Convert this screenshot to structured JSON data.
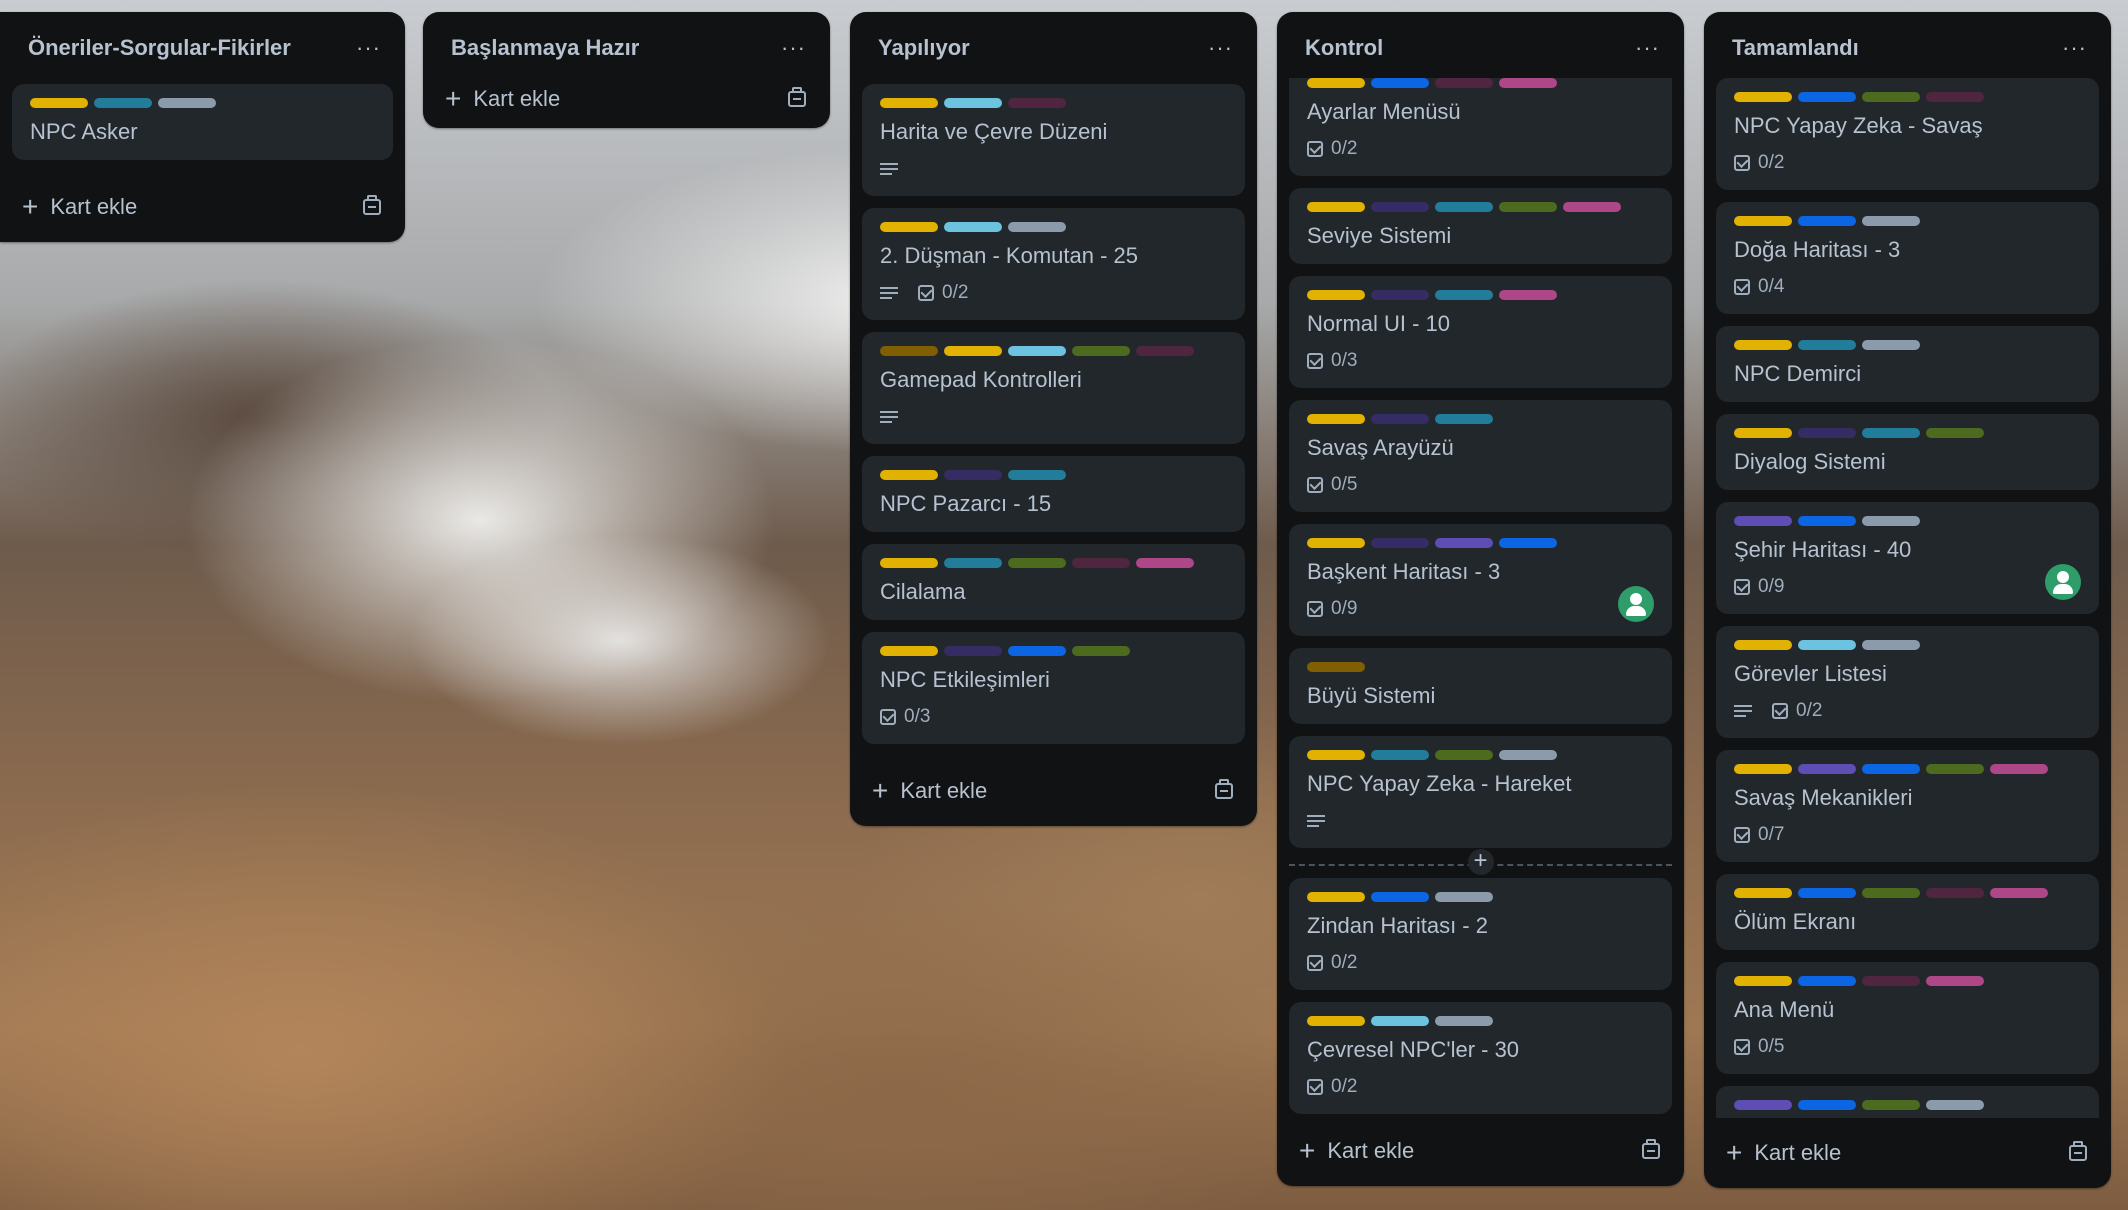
{
  "colors": {
    "yellow": "#e2b203",
    "lightblue": "#6cc3e0",
    "gray": "#8c9bab",
    "teal": "#227d9b",
    "maroon": "#50253f",
    "pink": "#ae4787",
    "green": "#4c6b1f",
    "navy": "#352c63",
    "blue": "#0c66e4",
    "purple": "#5e4db2",
    "olive": "#7f5f01"
  },
  "lists": [
    {
      "title": "Öneriler-Sorgular-Fikirler",
      "menu": "···",
      "add_label": "Kart ekle",
      "cards": [
        {
          "labels": [
            "yellow",
            "teal",
            "gray"
          ],
          "title": "NPC Asker"
        }
      ]
    },
    {
      "title": "Başlanmaya Hazır",
      "menu": "···",
      "add_label": "Kart ekle",
      "cards": []
    },
    {
      "title": "Yapılıyor",
      "menu": "···",
      "add_label": "Kart ekle",
      "cards": [
        {
          "labels": [
            "yellow",
            "lightblue",
            "maroon"
          ],
          "title": "Harita ve Çevre Düzeni",
          "desc": true
        },
        {
          "labels": [
            "yellow",
            "lightblue",
            "gray"
          ],
          "title": "2. Düşman - Komutan - 25",
          "desc": true,
          "checklist": "0/2"
        },
        {
          "labels": [
            "olive",
            "yellow",
            "lightblue",
            "green",
            "maroon"
          ],
          "title": "Gamepad Kontrolleri",
          "desc": true
        },
        {
          "labels": [
            "yellow",
            "navy",
            "teal"
          ],
          "title": "NPC Pazarcı - 15"
        },
        {
          "labels": [
            "yellow",
            "teal",
            "green",
            "maroon",
            "pink"
          ],
          "title": "Cilalama"
        },
        {
          "labels": [
            "yellow",
            "navy",
            "blue",
            "green"
          ],
          "title": "NPC Etkileşimleri",
          "checklist": "0/3"
        }
      ]
    },
    {
      "title": "Kontrol",
      "menu": "···",
      "add_label": "Kart ekle",
      "cards": [
        {
          "labels": [
            "yellow",
            "blue",
            "maroon",
            "pink"
          ],
          "title": "Ayarlar Menüsü",
          "checklist": "0/2"
        },
        {
          "labels": [
            "yellow",
            "navy",
            "teal",
            "green",
            "pink"
          ],
          "title": "Seviye Sistemi"
        },
        {
          "labels": [
            "yellow",
            "navy",
            "teal",
            "pink"
          ],
          "title": "Normal UI - 10",
          "checklist": "0/3"
        },
        {
          "labels": [
            "yellow",
            "navy",
            "teal"
          ],
          "title": "Savaş Arayüzü",
          "checklist": "0/5"
        },
        {
          "labels": [
            "yellow",
            "navy",
            "purple",
            "blue"
          ],
          "title": "Başkent Haritası - 3",
          "checklist": "0/9",
          "avatar": true
        },
        {
          "labels": [
            "olive"
          ],
          "title": "Büyü Sistemi"
        },
        {
          "labels": [
            "yellow",
            "teal",
            "green",
            "gray"
          ],
          "title": "NPC Yapay Zeka - Hareket",
          "desc": true,
          "drop_after": true
        },
        {
          "labels": [
            "yellow",
            "blue",
            "gray"
          ],
          "title": "Zindan Haritası - 2",
          "checklist": "0/2"
        },
        {
          "labels": [
            "yellow",
            "lightblue",
            "gray"
          ],
          "title": "Çevresel NPC'ler - 30",
          "checklist": "0/2"
        }
      ]
    },
    {
      "title": "Tamamlandı",
      "menu": "···",
      "add_label": "Kart ekle",
      "cards": [
        {
          "labels": [
            "yellow",
            "blue",
            "green",
            "maroon"
          ],
          "title": "NPC Yapay Zeka - Savaş",
          "checklist": "0/2"
        },
        {
          "labels": [
            "yellow",
            "blue",
            "gray"
          ],
          "title": "Doğa Haritası - 3",
          "checklist": "0/4"
        },
        {
          "labels": [
            "yellow",
            "teal",
            "gray"
          ],
          "title": "NPC Demirci"
        },
        {
          "labels": [
            "yellow",
            "navy",
            "teal",
            "green"
          ],
          "title": "Diyalog Sistemi"
        },
        {
          "labels": [
            "purple",
            "blue",
            "gray"
          ],
          "title": "Şehir Haritası - 40",
          "checklist": "0/9",
          "avatar": true
        },
        {
          "labels": [
            "yellow",
            "lightblue",
            "gray"
          ],
          "title": "Görevler Listesi",
          "desc": true,
          "checklist": "0/2"
        },
        {
          "labels": [
            "yellow",
            "purple",
            "blue",
            "green",
            "pink"
          ],
          "title": "Savaş Mekanikleri",
          "checklist": "0/7"
        },
        {
          "labels": [
            "yellow",
            "blue",
            "green",
            "maroon",
            "pink"
          ],
          "title": "Ölüm Ekranı"
        },
        {
          "labels": [
            "yellow",
            "blue",
            "maroon",
            "pink"
          ],
          "title": "Ana Menü",
          "checklist": "0/5"
        },
        {
          "labels": [
            "purple",
            "blue",
            "green",
            "gray"
          ],
          "title": ""
        }
      ]
    }
  ]
}
